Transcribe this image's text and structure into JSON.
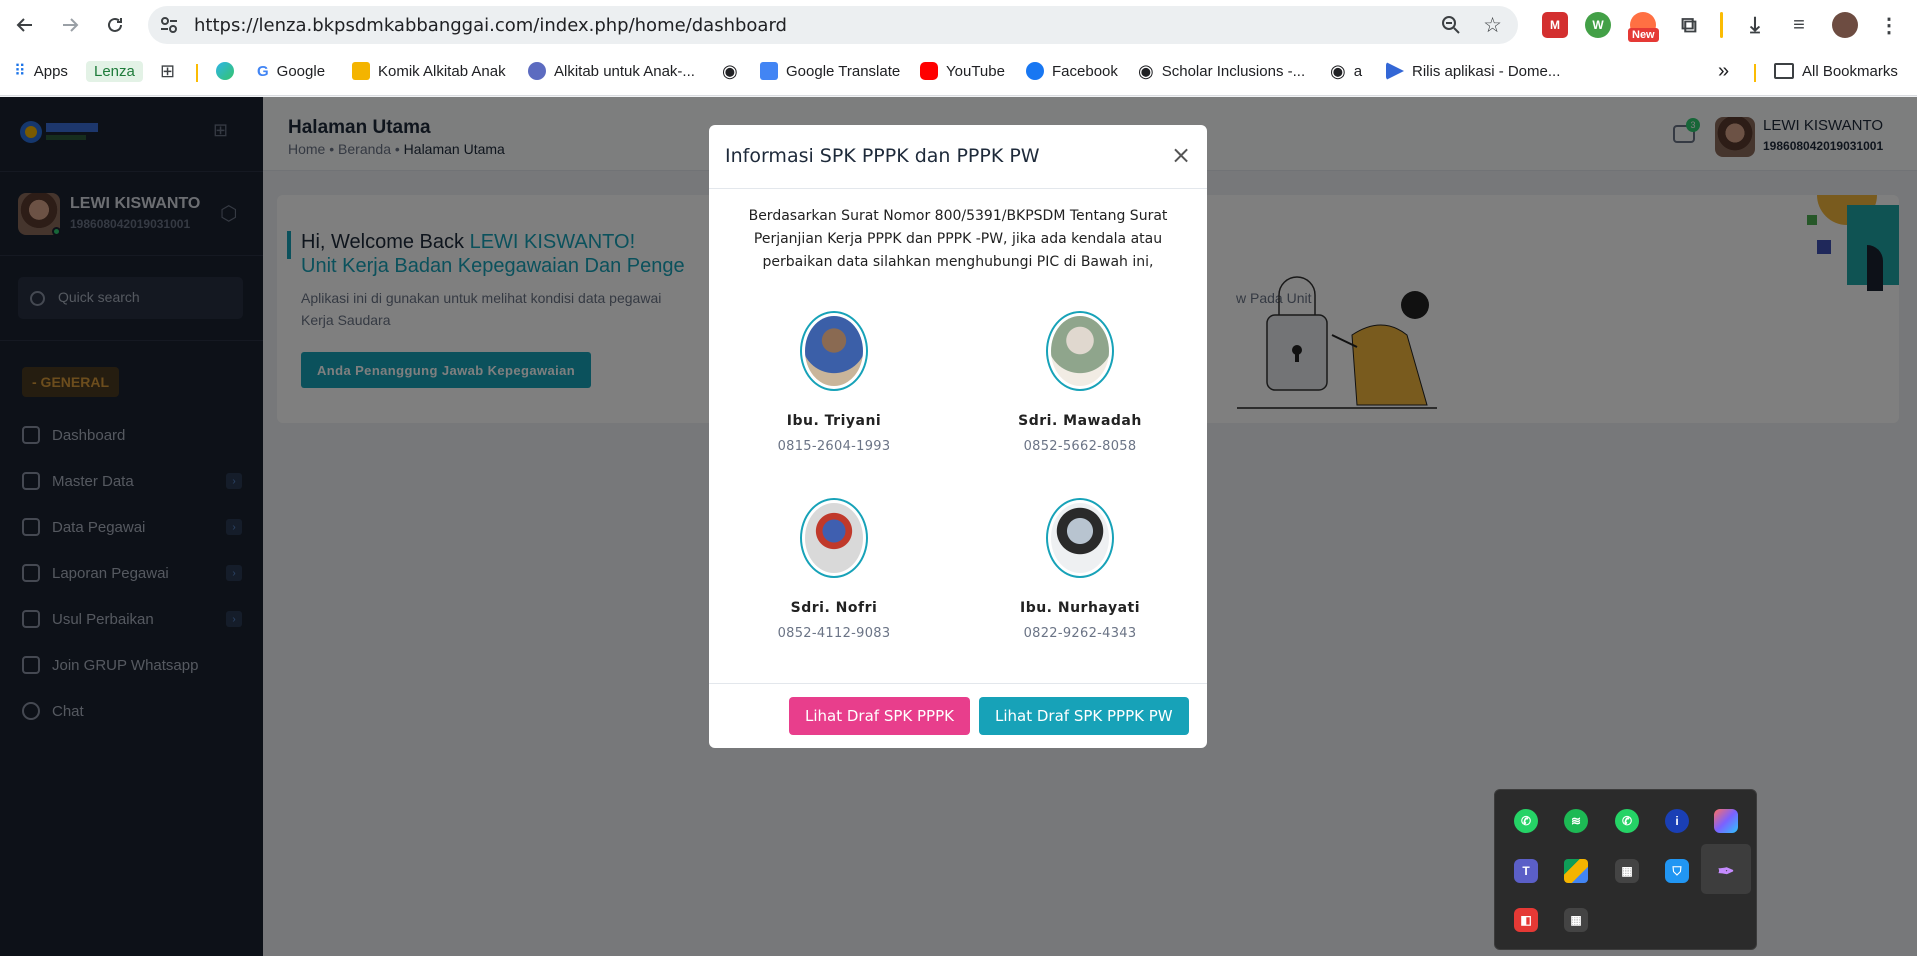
{
  "browser": {
    "url": "https://lenza.bkpsdmkabbanggai.com/index.php/home/dashboard",
    "new_badge": "New",
    "bookmarks": {
      "apps": "Apps",
      "lenza": "Lenza",
      "google": "Google",
      "komik": "Komik Alkitab Anak",
      "alkitab": "Alkitab untuk Anak-...",
      "translate": "Google Translate",
      "youtube": "YouTube",
      "facebook": "Facebook",
      "scholar": "Scholar Inclusions -...",
      "a": "a",
      "rilis": "Rilis aplikasi - Dome...",
      "more": "»",
      "all": "All Bookmarks"
    }
  },
  "sidebar": {
    "user_name": "LEWI KISWANTO",
    "user_nip": "198608042019031001",
    "search_placeholder": "Quick search",
    "section": "- GENERAL",
    "items": [
      {
        "label": "Dashboard"
      },
      {
        "label": "Master Data"
      },
      {
        "label": "Data Pegawai"
      },
      {
        "label": "Laporan Pegawai"
      },
      {
        "label": "Usul Perbaikan"
      },
      {
        "label": "Join GRUP Whatsapp"
      },
      {
        "label": "Chat"
      }
    ]
  },
  "header": {
    "title": "Halaman Utama",
    "crumb_home": "Home",
    "crumb_beranda": "Beranda",
    "crumb_active": "Halaman Utama",
    "notif_count": "3",
    "user_name": "LEWI KISWANTO",
    "user_nip": "198608042019031001"
  },
  "welcome": {
    "hello": "Hi, Welcome Back ",
    "name": "LEWI KISWANTO!",
    "unit": "Unit Kerja Badan Kepegawaian Dan Penge",
    "desc_left": "Aplikasi ini di gunakan untuk melihat kondisi data pegawai",
    "desc_right": "w Pada Unit",
    "desc_line2": "Kerja Saudara",
    "button": "Anda Penanggung Jawab Kepegawaian"
  },
  "modal": {
    "title": "Informasi SPK PPPK dan PPPK PW",
    "close": "×",
    "intro": "Berdasarkan Surat Nomor 800/5391/BKPSDM Tentang Surat Perjanjian Kerja PPPK dan PPPK -PW, jika ada kendala atau perbaikan data silahkan menghubungi PIC di Bawah ini,",
    "pics": [
      {
        "name": "Ibu. Triyani",
        "phone": "0815-2604-1993"
      },
      {
        "name": "Sdri. Mawadah",
        "phone": "0852-5662-8058"
      },
      {
        "name": "Sdri. Nofri",
        "phone": "0852-4112-9083"
      },
      {
        "name": "Ibu. Nurhayati",
        "phone": "0822-9262-4343"
      }
    ],
    "btn_pppk": "Lihat Draf SPK PPPK",
    "btn_pppk_pw": "Lihat Draf SPK PPPK PW"
  },
  "colors": {
    "accent": "#17a2b8",
    "pink_button": "#e83e8c",
    "sidebar_bg": "#1b2230",
    "general_label": "#d89a3b"
  },
  "icons": {
    "tray": [
      "whatsapp-icon",
      "spotify-icon",
      "whatsapp-icon",
      "info-icon",
      "copilot-icon",
      "teams-icon",
      "google-drive-icon",
      "clapperboard-icon",
      "defender-icon",
      "quill-icon",
      "screen-share-icon",
      "clapperboard-icon"
    ]
  }
}
